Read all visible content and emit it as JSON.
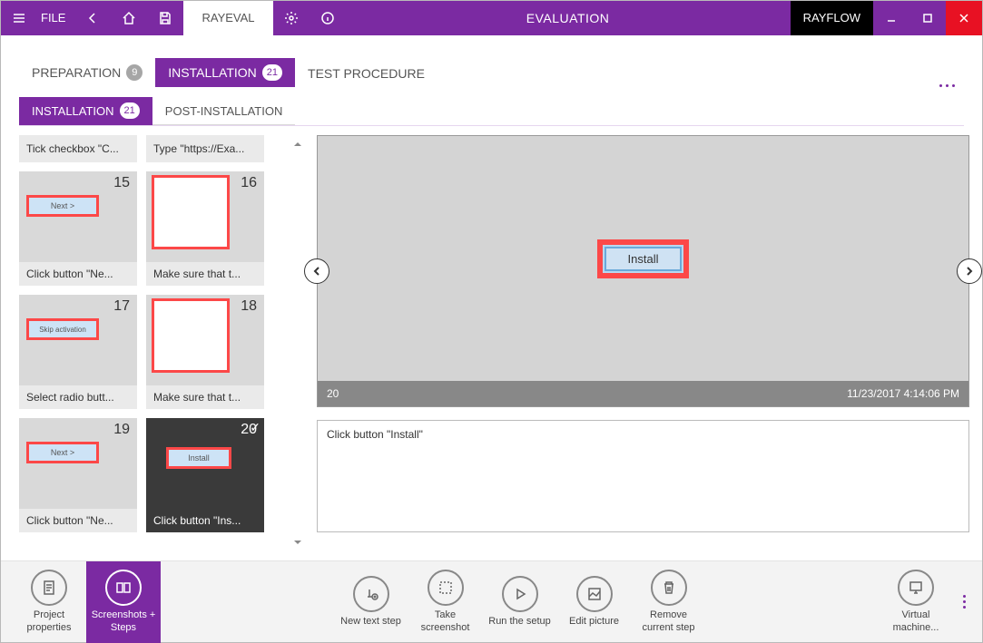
{
  "titlebar": {
    "file_label": "FILE",
    "tab_label": "RAYEVAL",
    "title": "EVALUATION",
    "rayflow_label": "RAYFLOW"
  },
  "tabs1": [
    {
      "label": "PREPARATION",
      "badge": "9",
      "active": false
    },
    {
      "label": "INSTALLATION",
      "badge": "21",
      "active": true
    },
    {
      "label": "TEST PROCEDURE",
      "badge": "",
      "active": false
    }
  ],
  "tabs2": [
    {
      "label": "INSTALLATION",
      "badge": "21",
      "active": true
    },
    {
      "label": "POST-INSTALLATION",
      "badge": "",
      "active": false
    }
  ],
  "steps": [
    {
      "num": "",
      "label": "Tick checkbox \"C...",
      "thumb": "text"
    },
    {
      "num": "",
      "label": "Type \"https://Exa...",
      "thumb": "text"
    },
    {
      "num": "15",
      "label": "Click button \"Ne...",
      "thumb": "next"
    },
    {
      "num": "16",
      "label": "Make sure that t...",
      "thumb": "dialog"
    },
    {
      "num": "17",
      "label": "Select radio butt...",
      "thumb": "skip"
    },
    {
      "num": "18",
      "label": "Make sure that t...",
      "thumb": "dialog"
    },
    {
      "num": "19",
      "label": "Click button \"Ne...",
      "thumb": "next"
    },
    {
      "num": "20",
      "label": "Click button \"Ins...",
      "thumb": "install",
      "selected": true
    }
  ],
  "preview": {
    "step_num": "20",
    "timestamp": "11/23/2017 4:14:06 PM",
    "button_text": "Install",
    "caption": "Click button \"Install\""
  },
  "bottombar": [
    {
      "label1": "Project",
      "label2": "properties",
      "icon": "doc"
    },
    {
      "label1": "Screenshots +",
      "label2": "Steps",
      "icon": "screens",
      "active": true
    },
    {
      "spacer": true
    },
    {
      "label1": "New text step",
      "label2": "",
      "icon": "textstep"
    },
    {
      "label1": "Take",
      "label2": "screenshot",
      "icon": "camera"
    },
    {
      "label1": "Run the setup",
      "label2": "",
      "icon": "play"
    },
    {
      "label1": "Edit picture",
      "label2": "",
      "icon": "edit"
    },
    {
      "label1": "Remove",
      "label2": "current step",
      "icon": "trash"
    },
    {
      "spacer": true
    },
    {
      "label1": "Virtual",
      "label2": "machine...",
      "icon": "vm"
    }
  ]
}
